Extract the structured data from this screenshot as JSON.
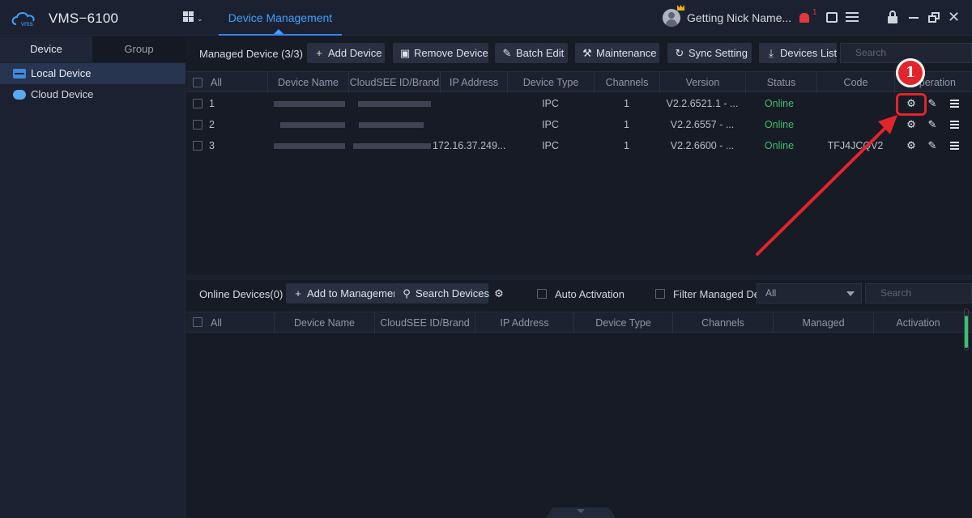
{
  "app": {
    "title": "VMS−6100",
    "logo_text": "vms",
    "nav_tab": "Device Management",
    "user_name": "Getting Nick Name...",
    "alarm_count": "1"
  },
  "sidebar": {
    "tabs": [
      "Device",
      "Group"
    ],
    "items": [
      {
        "label": "Local Device",
        "icon": "local-device-icon",
        "selected": true
      },
      {
        "label": "Cloud Device",
        "icon": "cloud-device-icon",
        "selected": false
      }
    ]
  },
  "managed": {
    "title": "Managed Device (3/3)",
    "buttons": {
      "add": "Add Device",
      "remove": "Remove Device",
      "batch_edit": "Batch Edit",
      "maintenance": "Maintenance",
      "sync": "Sync Setting",
      "list": "Devices List"
    },
    "search_placeholder": "Search",
    "columns": [
      "All",
      "Device Name",
      "CloudSEE ID/Brand",
      "IP Address",
      "Device Type",
      "Channels",
      "Version",
      "Status",
      "Code",
      "Operation"
    ],
    "rows": [
      {
        "num": "1",
        "ip": "",
        "type": "IPC",
        "channels": "1",
        "version": "V2.2.6521.1 - ...",
        "status": "Online",
        "code": ""
      },
      {
        "num": "2",
        "ip": "",
        "type": "IPC",
        "channels": "1",
        "version": "V2.2.6557 - ...",
        "status": "Online",
        "code": ""
      },
      {
        "num": "3",
        "ip": "172.16.37.249...",
        "type": "IPC",
        "channels": "1",
        "version": "V2.2.6600 - ...",
        "status": "Online",
        "code": "TFJ4JCQV2"
      }
    ]
  },
  "online": {
    "title": "Online Devices(0)",
    "add_button": "Add to Managemen",
    "search_button": "Search Devices",
    "auto_activation": "Auto Activation",
    "filter_label": "Filter Managed Dev",
    "filter_select": "All",
    "search_placeholder": "Search",
    "columns": [
      "All",
      "Device Name",
      "CloudSEE ID/Brand",
      "IP Address",
      "Device Type",
      "Channels",
      "Managed",
      "Activation"
    ]
  },
  "annotation": {
    "step": "1",
    "color": "#e3242b"
  },
  "colors": {
    "accent": "#3ea0ff",
    "online": "#3fbf6a",
    "alarm": "#e2363b",
    "background": "#161b26"
  }
}
